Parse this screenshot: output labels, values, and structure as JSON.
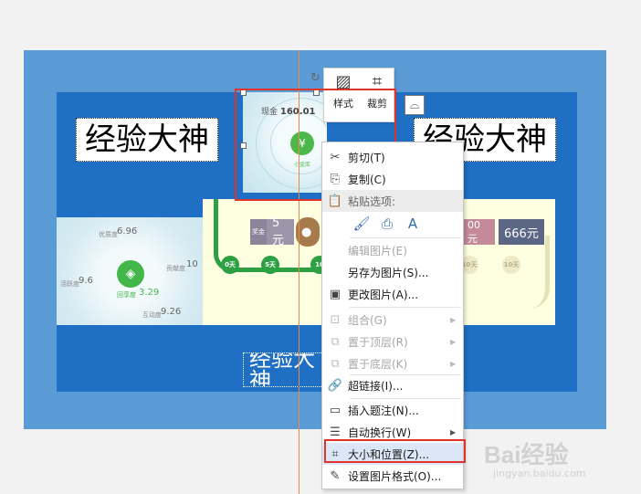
{
  "document": {
    "textbox_text": "经验大神",
    "textbox_bottom_text": "经验大神"
  },
  "selected_image": {
    "label": "现金",
    "value": "160.01",
    "icon": "yen-house-icon",
    "caption": "小金库"
  },
  "left_image": {
    "items": [
      {
        "label": "优质度",
        "value": "6.96"
      },
      {
        "label": "活跃度",
        "value": "9.6"
      },
      {
        "label": "贡献度",
        "value": "10"
      },
      {
        "label": "回享度",
        "value": "3.29"
      },
      {
        "label": "互动度",
        "value": "9.26"
      }
    ]
  },
  "right_image": {
    "days": [
      "0天",
      "5天",
      "10"
    ],
    "coupon_small_label": "奖金",
    "coupons": [
      "5元",
      "00元",
      "666元"
    ],
    "faded_day": "10天"
  },
  "mini_toolbar": {
    "style_label": "样式",
    "crop_label": "裁剪"
  },
  "context_menu": {
    "items": [
      {
        "label": "剪切(T)",
        "icon": "scissors-icon",
        "disabled": false
      },
      {
        "label": "复制(C)",
        "icon": "copy-icon",
        "disabled": false
      },
      {
        "label": "粘贴选项:",
        "icon": "paste-icon",
        "disabled": false
      },
      {
        "label": "编辑图片(E)",
        "icon": "",
        "disabled": true
      },
      {
        "label": "另存为图片(S)...",
        "icon": "",
        "disabled": false
      },
      {
        "label": "更改图片(A)...",
        "icon": "change-picture-icon",
        "disabled": false
      },
      {
        "label": "组合(G)",
        "icon": "group-icon",
        "disabled": true
      },
      {
        "label": "置于顶层(R)",
        "icon": "bring-front-icon",
        "disabled": true
      },
      {
        "label": "置于底层(K)",
        "icon": "send-back-icon",
        "disabled": true
      },
      {
        "label": "超链接(I)...",
        "icon": "hyperlink-icon",
        "disabled": false
      },
      {
        "label": "插入题注(N)...",
        "icon": "caption-icon",
        "disabled": false
      },
      {
        "label": "自动换行(W)",
        "icon": "wrap-text-icon",
        "disabled": false
      },
      {
        "label": "大小和位置(Z)...",
        "icon": "size-position-icon",
        "disabled": false
      },
      {
        "label": "设置图片格式(O)...",
        "icon": "format-picture-icon",
        "disabled": false
      }
    ]
  },
  "watermark": {
    "brand": "Bai经验",
    "url": "jingyan.baidu.com"
  }
}
